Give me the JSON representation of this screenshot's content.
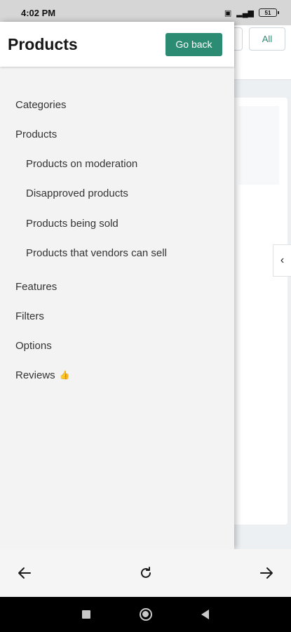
{
  "status_bar": {
    "time": "4:02 PM",
    "battery": "51"
  },
  "background": {
    "all_button": "All"
  },
  "drawer": {
    "title": "Products",
    "go_back_label": "Go back",
    "menu": [
      {
        "label": "Categories",
        "level": 0
      },
      {
        "label": "Products",
        "level": 0
      },
      {
        "label": "Products on moderation",
        "level": 1
      },
      {
        "label": "Disapproved products",
        "level": 1
      },
      {
        "label": "Products being sold",
        "level": 1
      },
      {
        "label": "Products that vendors can sell",
        "level": 1
      },
      {
        "label": "Features",
        "level": 0
      },
      {
        "label": "Filters",
        "level": 0
      },
      {
        "label": "Options",
        "level": 0
      },
      {
        "label": "Reviews",
        "level": 0,
        "icon": "thumbs-up-icon"
      }
    ]
  },
  "toolbar": {
    "back_icon": "arrow-left-icon",
    "reload_icon": "reload-icon",
    "forward_icon": "arrow-right-icon"
  },
  "colors": {
    "accent": "#2c8b73",
    "drawer_bg": "#f3f3f4",
    "status_bar": "#d6d6d6"
  }
}
